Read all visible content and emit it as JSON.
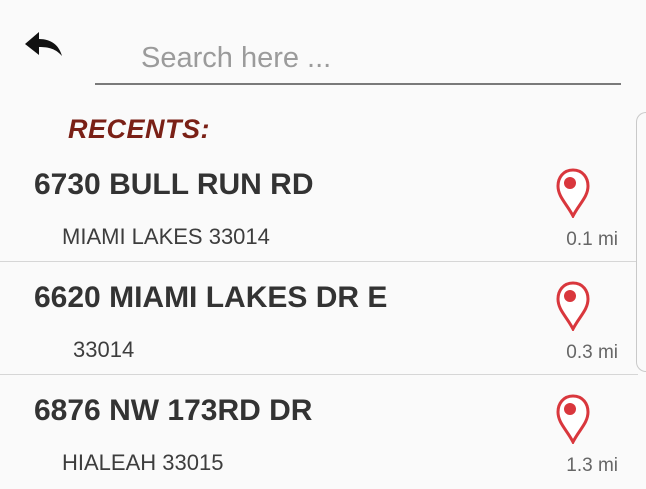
{
  "search": {
    "placeholder": "Search here ..."
  },
  "recents": {
    "heading": "RECENTS:",
    "items": [
      {
        "address": "6730 BULL RUN RD",
        "locality": "MIAMI LAKES  33014",
        "distance": "0.1 mi"
      },
      {
        "address": "6620 MIAMI LAKES DR E",
        "locality": "33014",
        "distance": "0.3 mi"
      },
      {
        "address": "6876 NW 173RD DR",
        "locality": "HIALEAH  33015",
        "distance": "1.3 mi"
      }
    ]
  },
  "colors": {
    "heading": "#7a2016",
    "pin": "#d9373d",
    "text": "#333333"
  }
}
